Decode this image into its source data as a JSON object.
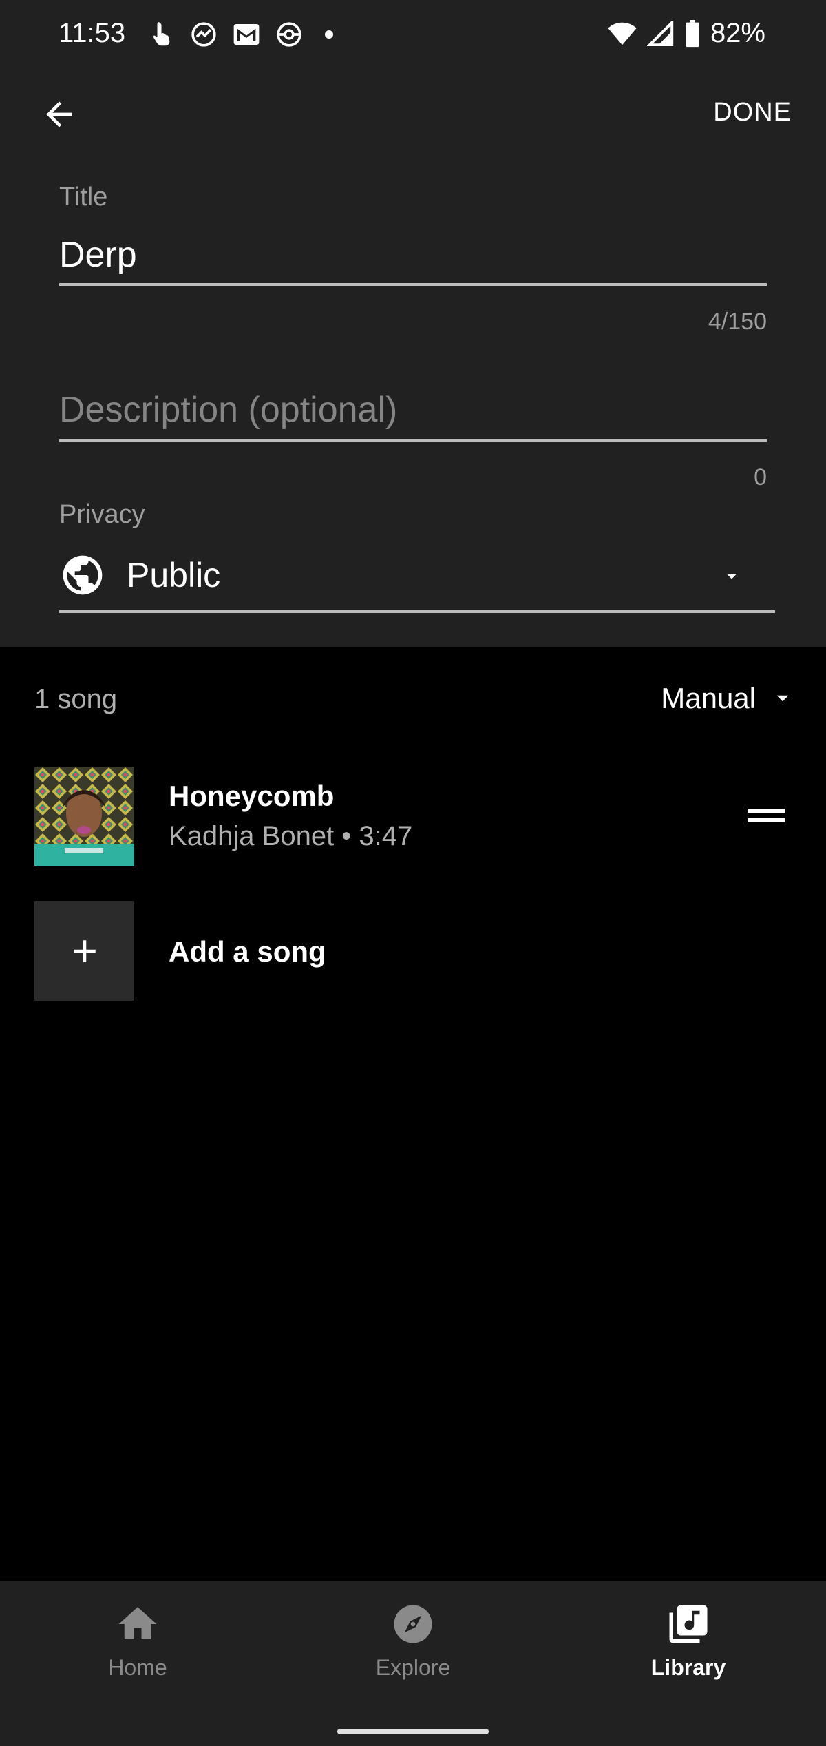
{
  "status_bar": {
    "time": "11:53",
    "battery": "82%",
    "left_icons": [
      "touch-icon",
      "speedometer-icon",
      "gmail-icon",
      "pokeball-icon",
      "dot-icon"
    ],
    "right_icons": [
      "wifi-icon",
      "cell-signal-icon",
      "battery-icon"
    ]
  },
  "app_bar": {
    "back_icon": "arrow-back-icon",
    "done_label": "DONE"
  },
  "form": {
    "title_label": "Title",
    "title_value": "Derp",
    "title_counter": "4/150",
    "description_placeholder": "Description (optional)",
    "description_value": "",
    "description_counter": "0",
    "privacy_label": "Privacy",
    "privacy_value": "Public",
    "privacy_icon": "globe-icon"
  },
  "playlist": {
    "song_count": "1 song",
    "sort_label": "Manual",
    "songs": [
      {
        "title": "Honeycomb",
        "meta": "Kadhja Bonet • 3:47"
      }
    ],
    "add_song_label": "Add a song"
  },
  "bottom_nav": {
    "items": [
      {
        "label": "Home",
        "icon": "home-icon",
        "active": false
      },
      {
        "label": "Explore",
        "icon": "compass-icon",
        "active": false
      },
      {
        "label": "Library",
        "icon": "library-music-icon",
        "active": true
      }
    ]
  },
  "colors": {
    "panel_bg": "#212121",
    "list_bg": "#000000",
    "secondary_text": "#9e9e9e"
  }
}
